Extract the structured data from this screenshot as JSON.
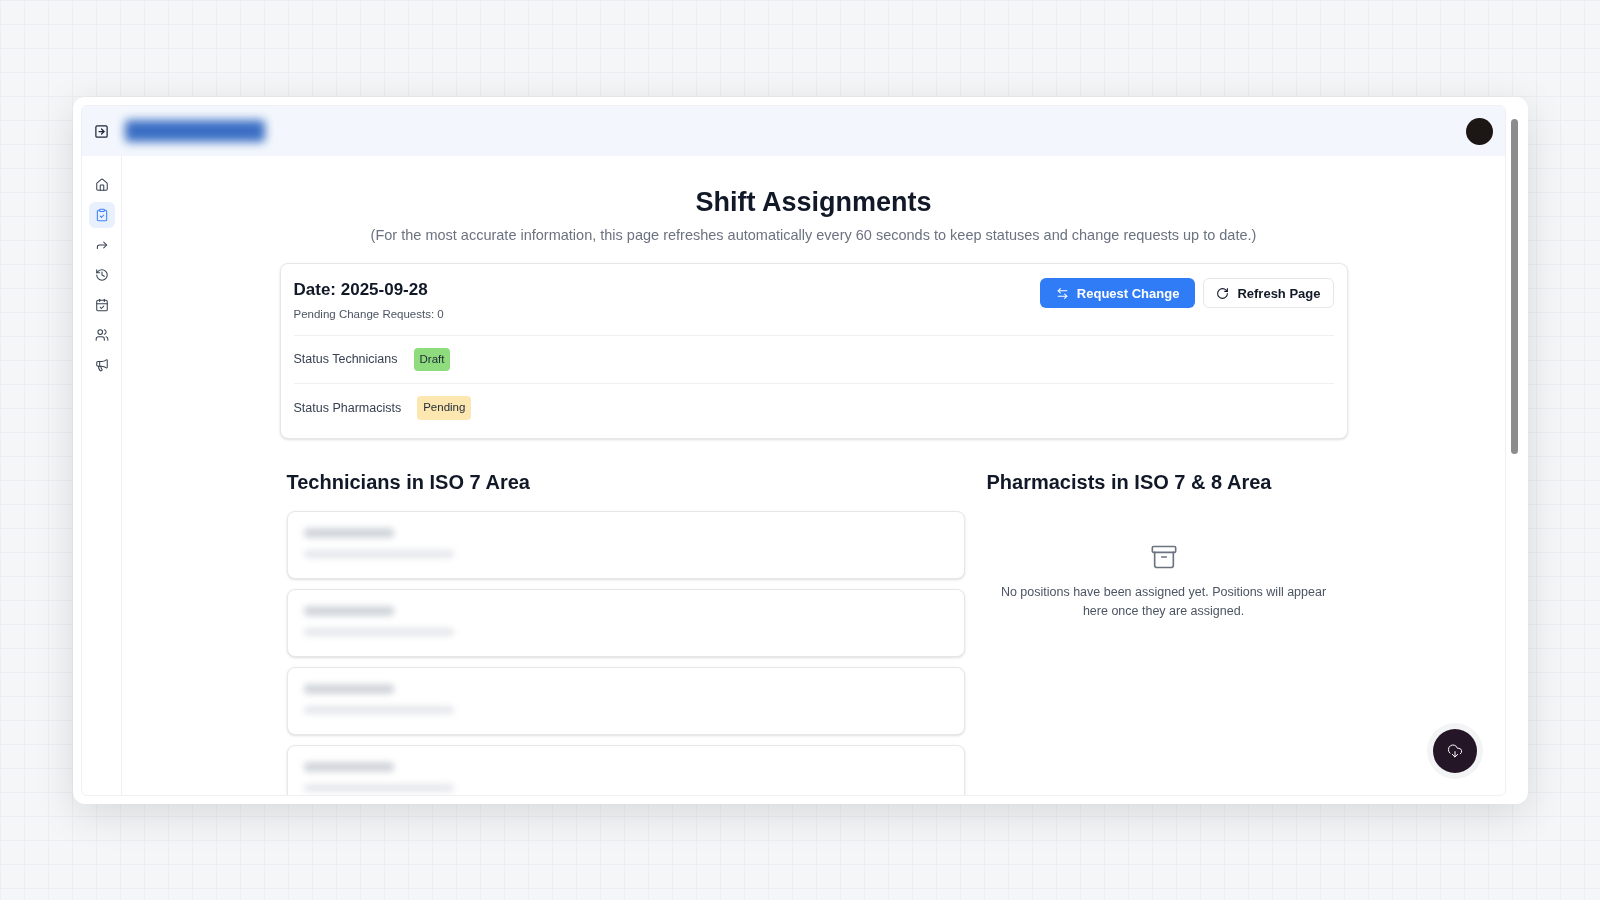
{
  "sidebar": {
    "items": [
      {
        "kind": "home",
        "selected": false
      },
      {
        "kind": "assignments",
        "selected": true
      },
      {
        "kind": "forward",
        "selected": false
      },
      {
        "kind": "history",
        "selected": false
      },
      {
        "kind": "calendar",
        "selected": false
      },
      {
        "kind": "people",
        "selected": false
      },
      {
        "kind": "announcements",
        "selected": false
      }
    ]
  },
  "page": {
    "title": "Shift Assignments",
    "subtitle": "(For the most accurate information, this page refreshes automatically every 60 seconds to keep statuses and change requests up to date.)"
  },
  "summary": {
    "date": "Date: 2025-09-28",
    "pending": "Pending Change Requests: 0",
    "buttons": [
      {
        "kind": "primary",
        "label": "Request Change"
      },
      {
        "kind": "secondary",
        "label": "Refresh Page"
      }
    ],
    "statuses": [
      {
        "label": "Status Technicians",
        "badge": "Draft",
        "color": "#8fdc7e"
      },
      {
        "label": "Status Pharmacists",
        "badge": "Pending",
        "color": "#fde7b0"
      }
    ]
  },
  "technicians": {
    "title": "Technicians in ISO 7 Area",
    "cards": [
      {
        "kind": "redacted"
      },
      {
        "kind": "redacted"
      },
      {
        "kind": "redacted"
      },
      {
        "kind": "redacted"
      }
    ]
  },
  "pharmacists": {
    "title": "Pharmacists in ISO 7 & 8 Area",
    "empty_message": "No positions have been assigned yet. Positions will appear here once they are assigned."
  }
}
